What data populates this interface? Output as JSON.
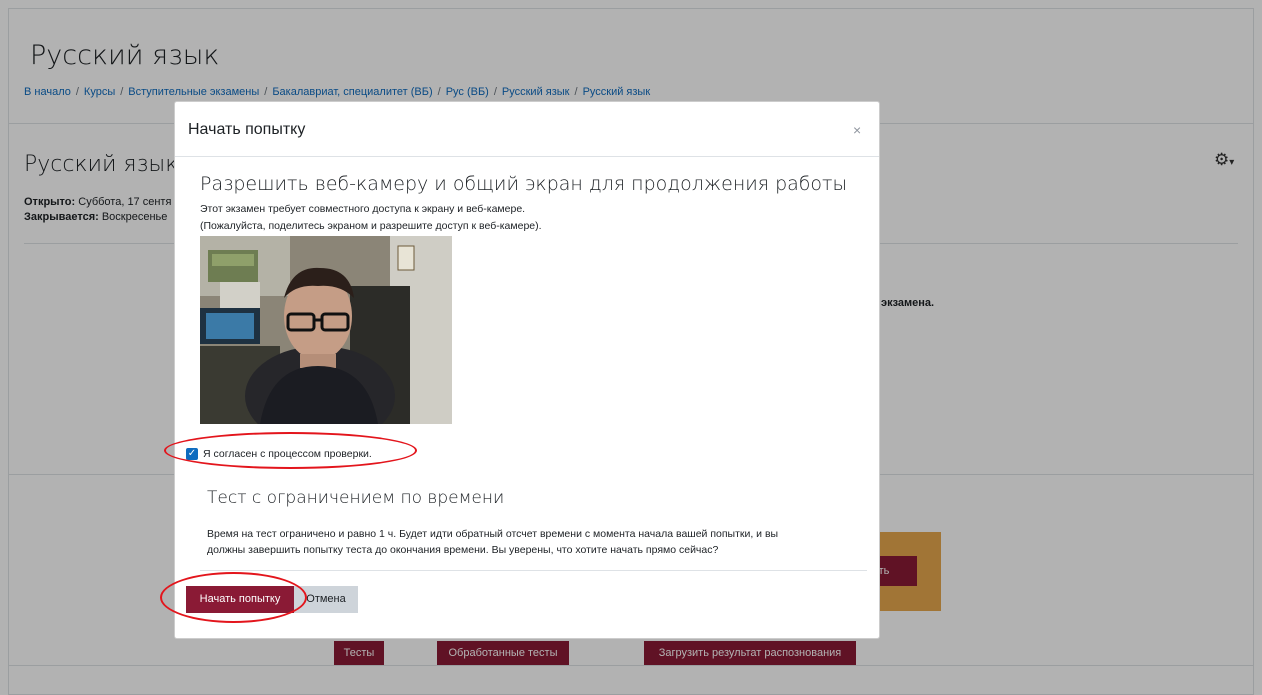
{
  "page": {
    "title": "Русский язык",
    "breadcrumb": [
      "В начало",
      "Курсы",
      "Вступительные экзамены",
      "Бакалавриат, специалитет (ВБ)",
      "Рус (ВБ)",
      "Русский язык",
      "Русский язык"
    ],
    "breadcrumb_sep": "/"
  },
  "background": {
    "section_title": "Русский язык",
    "opened_label": "Открыто:",
    "opened_value": "Суббота, 17 сентя",
    "closes_label": "Закрывается:",
    "closes_value": "Воскресенье",
    "hidden_text": "экзамена.",
    "behind_button": "вать",
    "buttons": [
      "Тесты",
      "Обработанные тесты",
      "Загрузить результат распознования"
    ]
  },
  "modal": {
    "title": "Начать попытку",
    "close": "×",
    "proctoring_title": "Разрешить веб-камеру и общий экран для продолжения работы",
    "proctoring_line1": "Этот экзамен требует совместного доступа к экрану и веб-камере.",
    "proctoring_line2": "(Пожалуйста, поделитесь экраном и разрешите доступ к веб-камере).",
    "consent_label": "Я согласен с процессом проверки.",
    "consent_checked": "✓",
    "time_title": "Тест с ограничением по времени",
    "time_line1": "Время на тест ограничено и равно 1 ч. Будет идти обратный отсчет времени с момента начала вашей попытки, и вы",
    "time_line2": "должны завершить попытку теста до окончания времени. Вы уверены, что хотите начать прямо сейчас?",
    "start_button": "Начать попытку",
    "cancel_button": "Отмена"
  },
  "colors": {
    "primary": "#8a1a35",
    "link": "#0f6cbf",
    "annotation": "#e3151c"
  },
  "icons": {
    "gear": "gear-icon",
    "close": "close-icon",
    "check": "checkbox"
  }
}
